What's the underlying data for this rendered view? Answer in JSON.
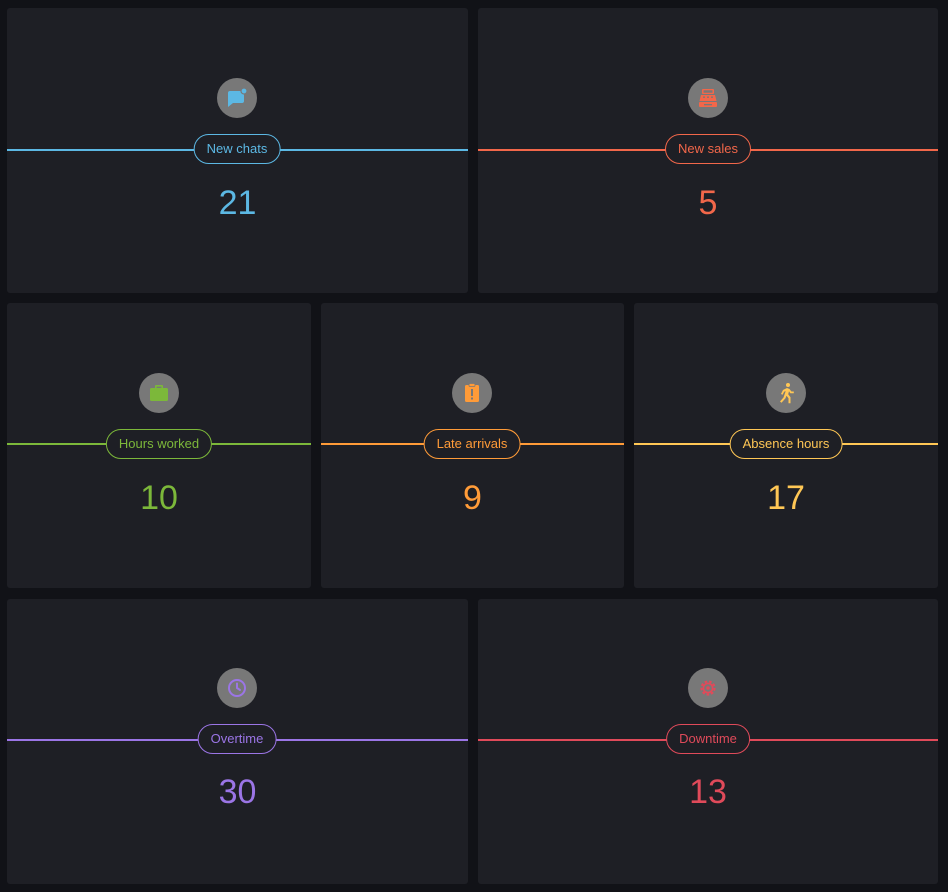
{
  "widgets": [
    {
      "label": "New chats",
      "value": "21",
      "color": "#5cb8e4",
      "icon": "chat-bubble-icon"
    },
    {
      "label": "New sales",
      "value": "5",
      "color": "#f2674a",
      "icon": "cash-register-icon"
    },
    {
      "label": "Hours worked",
      "value": "10",
      "color": "#7cb83a",
      "icon": "briefcase-icon"
    },
    {
      "label": "Late arrivals",
      "value": "9",
      "color": "#ff9b38",
      "icon": "alert-clipboard-icon"
    },
    {
      "label": "Absence hours",
      "value": "17",
      "color": "#ffc755",
      "icon": "running-person-icon"
    },
    {
      "label": "Overtime",
      "value": "30",
      "color": "#9b75e6",
      "icon": "clock-icon"
    },
    {
      "label": "Downtime",
      "value": "13",
      "color": "#e04a5a",
      "icon": "cog-icon"
    }
  ]
}
